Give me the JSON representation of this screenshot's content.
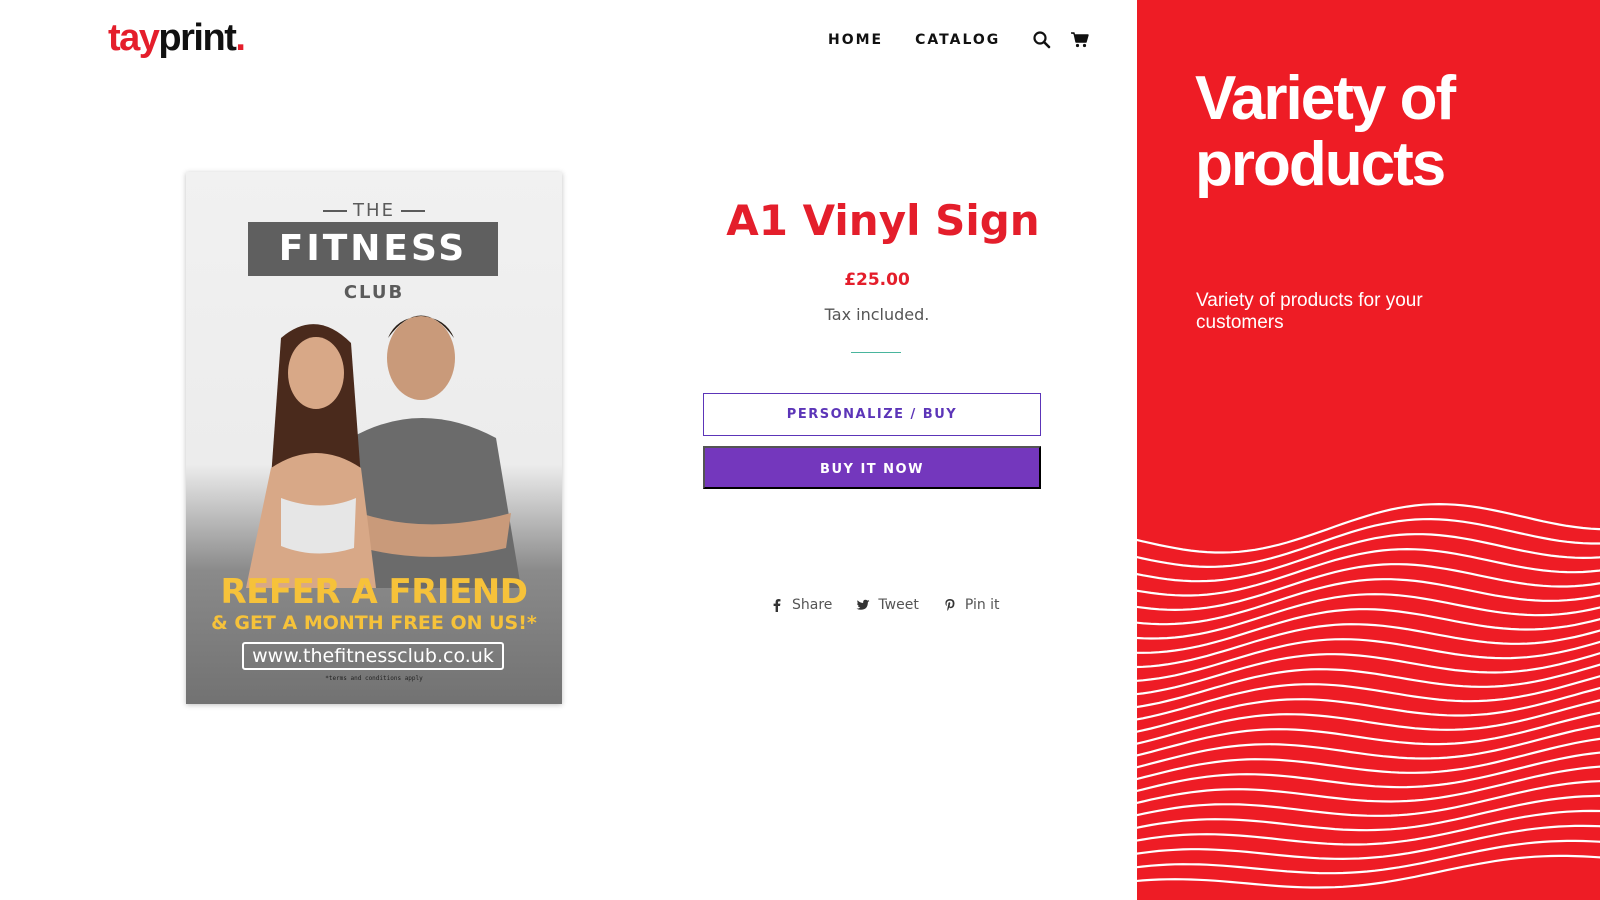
{
  "header": {
    "logo": {
      "part1": "tay",
      "part2": "print",
      "dot": "."
    },
    "nav": {
      "home": "HOME",
      "catalog": "CATALOG"
    },
    "icons": {
      "search": "search-icon",
      "cart": "cart-icon"
    }
  },
  "product": {
    "title": "A1 Vinyl Sign",
    "price": "£25.00",
    "tax_note": "Tax included.",
    "personalize_label": "PERSONALIZE / BUY",
    "buy_now_label": "BUY IT NOW",
    "image": {
      "brand_top": "THE",
      "brand_main": "FITNESS",
      "brand_bottom": "CLUB",
      "headline": "REFER A FRIEND",
      "subline": "& GET A MONTH FREE ON US!*",
      "url": "www.thefitnessclub.co.uk",
      "terms": "*terms and conditions apply"
    }
  },
  "share": {
    "facebook": "Share",
    "twitter": "Tweet",
    "pinterest": "Pin it"
  },
  "promo": {
    "heading": "Variety of products",
    "text": "Variety of products for your customers"
  },
  "colors": {
    "brand_red": "#ee1c25",
    "purple": "#7437bd",
    "divider": "#49b59d"
  }
}
